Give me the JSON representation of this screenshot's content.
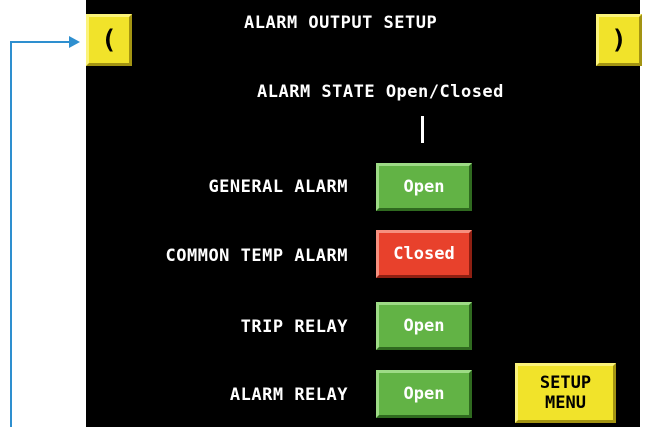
{
  "screen": {
    "title": "ALARM OUTPUT SETUP",
    "nav": {
      "prev_label": "(",
      "next_label": ")"
    },
    "state_heading": "ALARM STATE Open/Closed",
    "rows": [
      {
        "label": "GENERAL ALARM",
        "state": "Open"
      },
      {
        "label": "COMMON TEMP ALARM",
        "state": "Closed"
      },
      {
        "label": "TRIP RELAY",
        "state": "Open"
      },
      {
        "label": "ALARM RELAY",
        "state": "Open"
      }
    ],
    "setup_menu": {
      "line1": "SETUP",
      "line2": "MENU"
    }
  },
  "colors": {
    "screen_background": "#000000",
    "nav_button": "#f1e32a",
    "state_open": "#62b345",
    "state_closed": "#e8412c",
    "callout": "#2e8fcf"
  }
}
